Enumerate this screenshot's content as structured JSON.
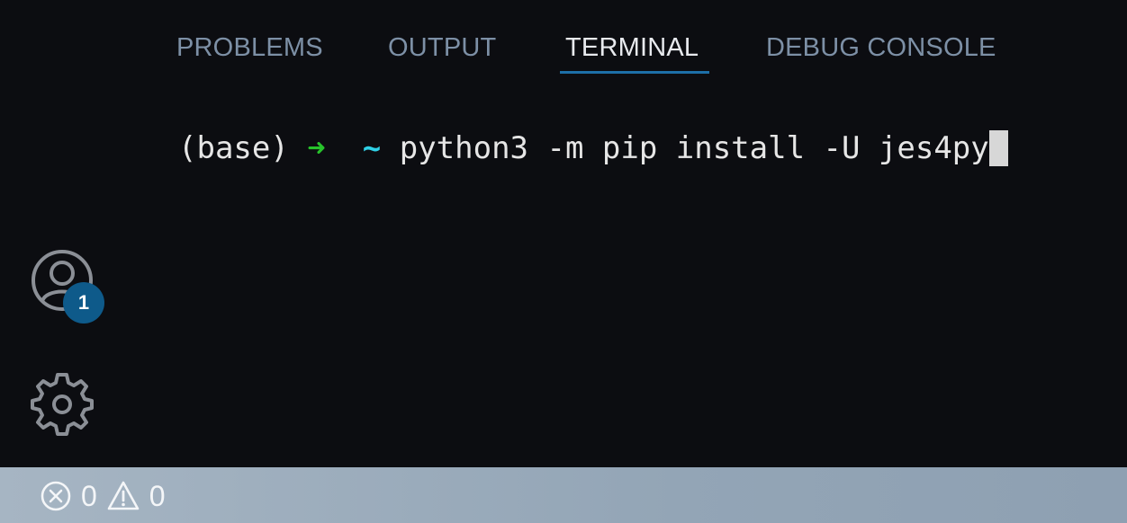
{
  "panel": {
    "tabs": [
      {
        "label": "PROBLEMS",
        "active": false
      },
      {
        "label": "OUTPUT",
        "active": false
      },
      {
        "label": "TERMINAL",
        "active": true
      },
      {
        "label": "DEBUG CONSOLE",
        "active": false
      }
    ]
  },
  "terminal": {
    "env": "(base)",
    "arrow": "➜",
    "cwd": "~",
    "command": "python3 -m pip install -U jes4py"
  },
  "activity_bar": {
    "accounts": {
      "icon": "account-icon",
      "badge": "1"
    },
    "manage": {
      "icon": "gear-icon"
    }
  },
  "status_bar": {
    "errors": "0",
    "warnings": "0",
    "error_icon": "error-icon",
    "warning_icon": "warning-icon"
  },
  "colors": {
    "background": "#0c0d11",
    "tab_inactive": "#7d90a6",
    "tab_active": "#e8eaee",
    "tab_underline": "#1d6fa8",
    "prompt_arrow": "#27c22b",
    "prompt_cwd": "#2fd0e6",
    "badge": "#0e5a8a",
    "status_bar": "#9aaabb"
  }
}
